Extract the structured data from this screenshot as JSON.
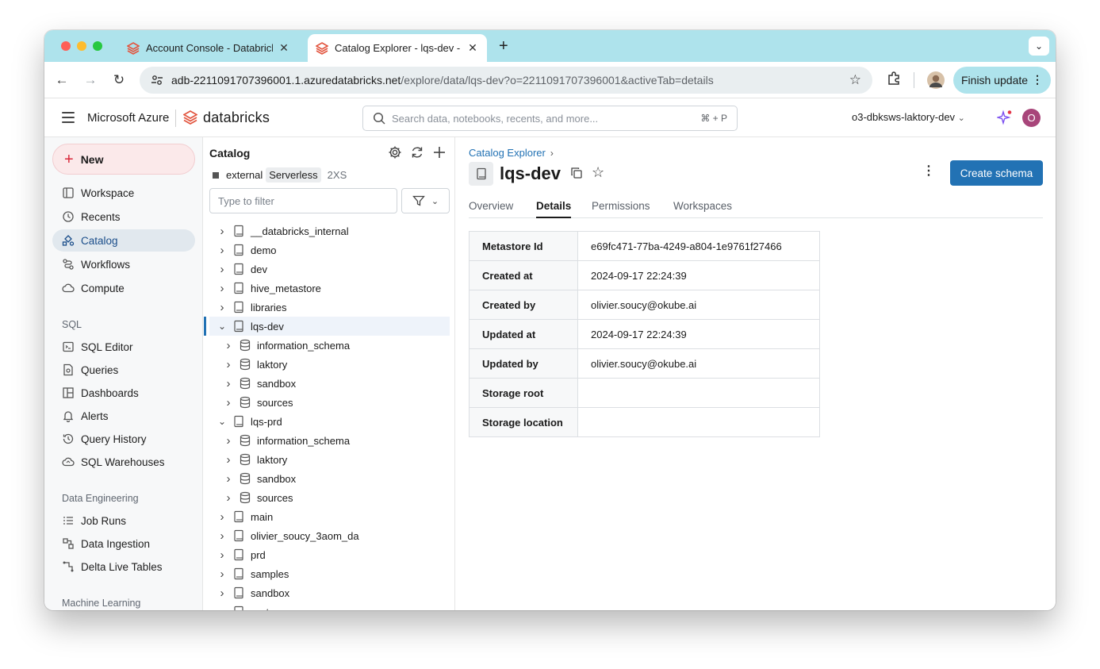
{
  "browser": {
    "tabs": [
      {
        "title": "Account Console - Databricks",
        "active": false
      },
      {
        "title": "Catalog Explorer - lqs-dev - Databricks",
        "active": true
      }
    ],
    "url_host": "adb-2211091707396001.1.azuredatabricks.net",
    "url_path": "/explore/data/lqs-dev?o=2211091707396001&activeTab=details",
    "finish_update_label": "Finish update"
  },
  "header": {
    "brand": "Microsoft Azure",
    "product": "databricks",
    "search_placeholder": "Search data, notebooks, recents, and more...",
    "search_shortcut": "⌘ + P",
    "workspace_name": "o3-dbksws-laktory-dev",
    "avatar_initial": "O"
  },
  "sidebar": {
    "new_label": "New",
    "items_top": [
      {
        "label": "Workspace",
        "icon": "workspace-icon"
      },
      {
        "label": "Recents",
        "icon": "clock-icon"
      },
      {
        "label": "Catalog",
        "icon": "catalog-icon",
        "active": true
      },
      {
        "label": "Workflows",
        "icon": "workflows-icon"
      },
      {
        "label": "Compute",
        "icon": "cloud-icon"
      }
    ],
    "sql_section": "SQL",
    "sql_items": [
      {
        "label": "SQL Editor"
      },
      {
        "label": "Queries"
      },
      {
        "label": "Dashboards"
      },
      {
        "label": "Alerts"
      },
      {
        "label": "Query History"
      },
      {
        "label": "SQL Warehouses"
      }
    ],
    "de_section": "Data Engineering",
    "de_items": [
      {
        "label": "Job Runs"
      },
      {
        "label": "Data Ingestion"
      },
      {
        "label": "Delta Live Tables"
      }
    ],
    "ml_section": "Machine Learning"
  },
  "catalog_pane": {
    "title": "Catalog",
    "compute_name": "external",
    "compute_type": "Serverless",
    "compute_size": "2XS",
    "filter_placeholder": "Type to filter",
    "tree": [
      {
        "label": "__databricks_internal",
        "level": 0,
        "kind": "catalog",
        "expanded": false
      },
      {
        "label": "demo",
        "level": 0,
        "kind": "catalog",
        "expanded": false
      },
      {
        "label": "dev",
        "level": 0,
        "kind": "catalog",
        "expanded": false
      },
      {
        "label": "hive_metastore",
        "level": 0,
        "kind": "catalog",
        "expanded": false
      },
      {
        "label": "libraries",
        "level": 0,
        "kind": "catalog",
        "expanded": false
      },
      {
        "label": "lqs-dev",
        "level": 0,
        "kind": "catalog",
        "expanded": true,
        "selected": true
      },
      {
        "label": "information_schema",
        "level": 1,
        "kind": "schema",
        "expanded": false
      },
      {
        "label": "laktory",
        "level": 1,
        "kind": "schema",
        "expanded": false
      },
      {
        "label": "sandbox",
        "level": 1,
        "kind": "schema",
        "expanded": false
      },
      {
        "label": "sources",
        "level": 1,
        "kind": "schema",
        "expanded": false
      },
      {
        "label": "lqs-prd",
        "level": 0,
        "kind": "catalog",
        "expanded": true
      },
      {
        "label": "information_schema",
        "level": 1,
        "kind": "schema",
        "expanded": false
      },
      {
        "label": "laktory",
        "level": 1,
        "kind": "schema",
        "expanded": false
      },
      {
        "label": "sandbox",
        "level": 1,
        "kind": "schema",
        "expanded": false
      },
      {
        "label": "sources",
        "level": 1,
        "kind": "schema",
        "expanded": false
      },
      {
        "label": "main",
        "level": 0,
        "kind": "catalog",
        "expanded": false
      },
      {
        "label": "olivier_soucy_3aom_da",
        "level": 0,
        "kind": "catalog",
        "expanded": false
      },
      {
        "label": "prd",
        "level": 0,
        "kind": "catalog",
        "expanded": false
      },
      {
        "label": "samples",
        "level": 0,
        "kind": "catalog",
        "expanded": false
      },
      {
        "label": "sandbox",
        "level": 0,
        "kind": "catalog",
        "expanded": false
      },
      {
        "label": "system",
        "level": 0,
        "kind": "catalog",
        "expanded": false
      }
    ]
  },
  "main": {
    "breadcrumb": "Catalog Explorer",
    "title": "lqs-dev",
    "create_button": "Create schema",
    "tabs": [
      {
        "label": "Overview",
        "active": false
      },
      {
        "label": "Details",
        "active": true
      },
      {
        "label": "Permissions",
        "active": false
      },
      {
        "label": "Workspaces",
        "active": false
      }
    ],
    "details": [
      {
        "key": "Metastore Id",
        "value": "e69fc471-77ba-4249-a804-1e9761f27466"
      },
      {
        "key": "Created at",
        "value": "2024-09-17 22:24:39"
      },
      {
        "key": "Created by",
        "value": "olivier.soucy@okube.ai"
      },
      {
        "key": "Updated at",
        "value": "2024-09-17 22:24:39"
      },
      {
        "key": "Updated by",
        "value": "olivier.soucy@okube.ai"
      },
      {
        "key": "Storage root",
        "value": ""
      },
      {
        "key": "Storage location",
        "value": ""
      }
    ]
  },
  "colors": {
    "accent": "#2272b4",
    "brand_red": "#d9283a",
    "tabstrip": "#aee3ec"
  }
}
